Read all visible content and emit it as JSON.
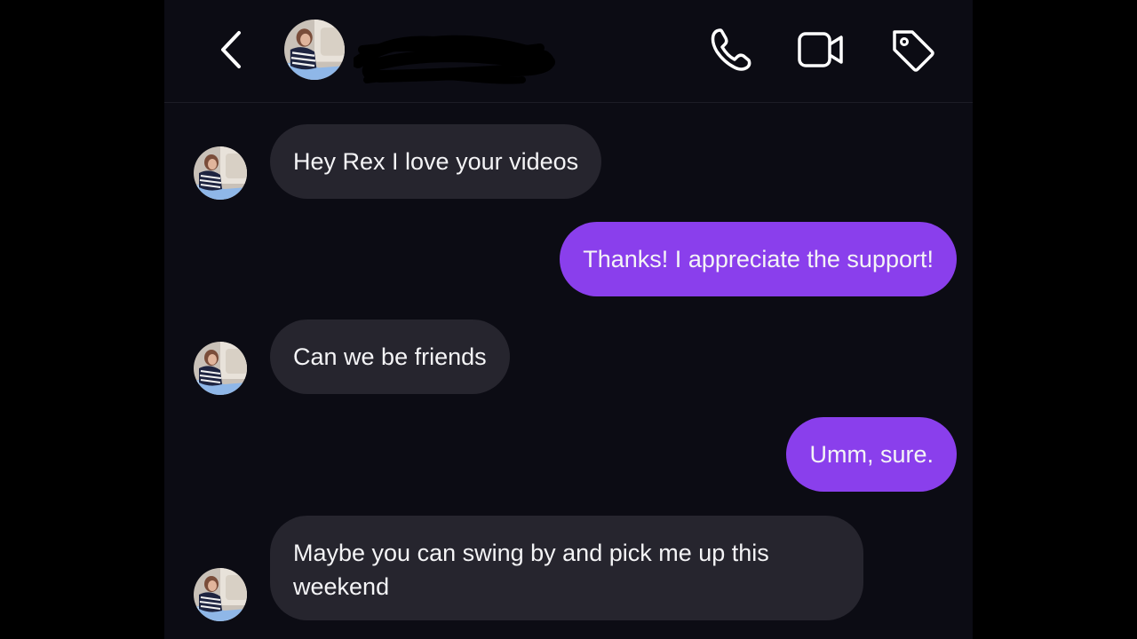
{
  "header": {
    "contact_name": "",
    "back_icon": "chevron-left-icon",
    "call_icon": "phone-icon",
    "video_icon": "video-camera-icon",
    "tag_icon": "tag-icon"
  },
  "colors": {
    "background": "#0c0c14",
    "incoming_bubble": "#26252e",
    "outgoing_bubble": "#8a3fec",
    "text": "#f4f4f6"
  },
  "messages": [
    {
      "direction": "incoming",
      "text": "Hey Rex I love your videos"
    },
    {
      "direction": "outgoing",
      "text": "Thanks! I appreciate the support!"
    },
    {
      "direction": "incoming",
      "text": "Can we be friends"
    },
    {
      "direction": "outgoing",
      "text": "Umm, sure."
    },
    {
      "direction": "incoming",
      "text": "Maybe you can swing by and pick me up this weekend"
    }
  ]
}
